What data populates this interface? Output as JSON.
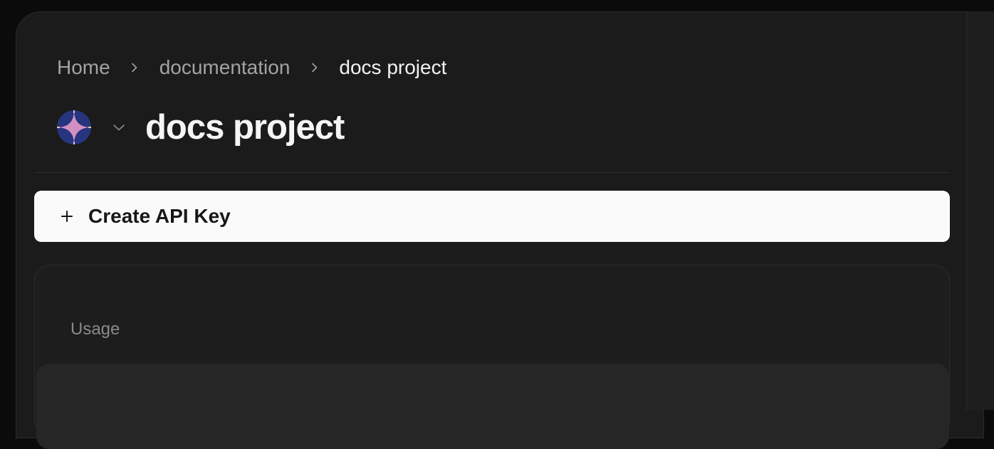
{
  "breadcrumb": {
    "items": [
      "Home",
      "documentation",
      "docs project"
    ]
  },
  "project": {
    "title": "docs project",
    "logo_icon": "four-point-star-logo",
    "colors": {
      "logo_bg": "#27357f",
      "logo_star": "#cf8fc0"
    }
  },
  "actions": {
    "create_api_key": "Create API Key"
  },
  "usage": {
    "title": "Usage"
  }
}
